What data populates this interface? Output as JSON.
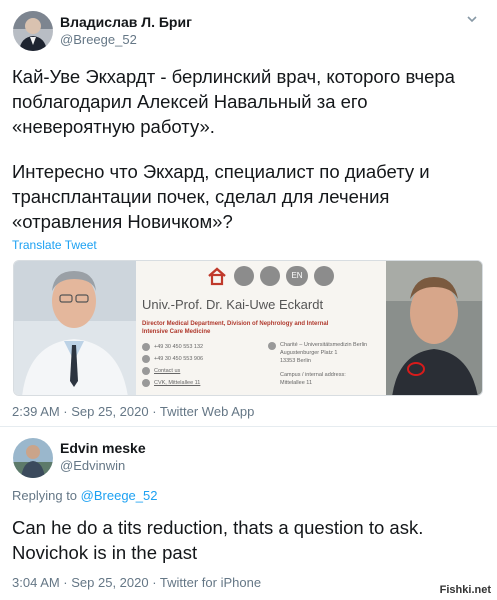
{
  "tweet1": {
    "author_name": "Владислав Л. Бриг",
    "author_handle": "@Breege_52",
    "text_line1": "Кай-Уве Экхардт - берлинский врач, которого вчера",
    "text_line2": "поблагодарил Алексей Навальный за его",
    "text_line3": "«невероятную работу».",
    "text_line4": "Интересно что Экхард, специалист по диабету и",
    "text_line5": "трансплантации почек, сделал для лечения",
    "text_line6": "«отравления Новичком»?",
    "translate_label": "Translate Tweet",
    "media": {
      "profile_title": "Univ.-Prof. Dr. Kai-Uwe Eckardt",
      "department_line1": "Director Medical Department, Division of Nephrology and Internal",
      "department_line2": "Intensive Care Medicine",
      "phone1": "+49 30 450 553 132",
      "phone2": "+49 30 450 553 906",
      "contact": "Contact us",
      "location": "CVK, Mittelallee 11",
      "address_line1": "Charité – Universitätsmedizin Berlin",
      "address_line2": "Augustenburger Platz 1",
      "address_line3": "13353 Berlin",
      "campus_line1": "Campus / internal address:",
      "campus_line2": "Mittelallee 11",
      "lang_badge": "EN"
    },
    "meta": "2:39 AM · Sep 25, 2020 · Twitter Web App"
  },
  "tweet2": {
    "author_name": "Edvin meske",
    "author_handle": "@Edvinwin",
    "replying_prefix": "Replying to",
    "replying_handle": "@Breege_52",
    "text_line1": "Can he do a tits reduction, thats a question to ask.",
    "text_line2": "Novichok is in the past",
    "meta": "3:04 AM · Sep 25, 2020 · Twitter for iPhone"
  },
  "watermark": "Fishki.net",
  "colors": {
    "link": "#1da1f2",
    "muted": "#657786",
    "home_icon": "#c0392b"
  }
}
